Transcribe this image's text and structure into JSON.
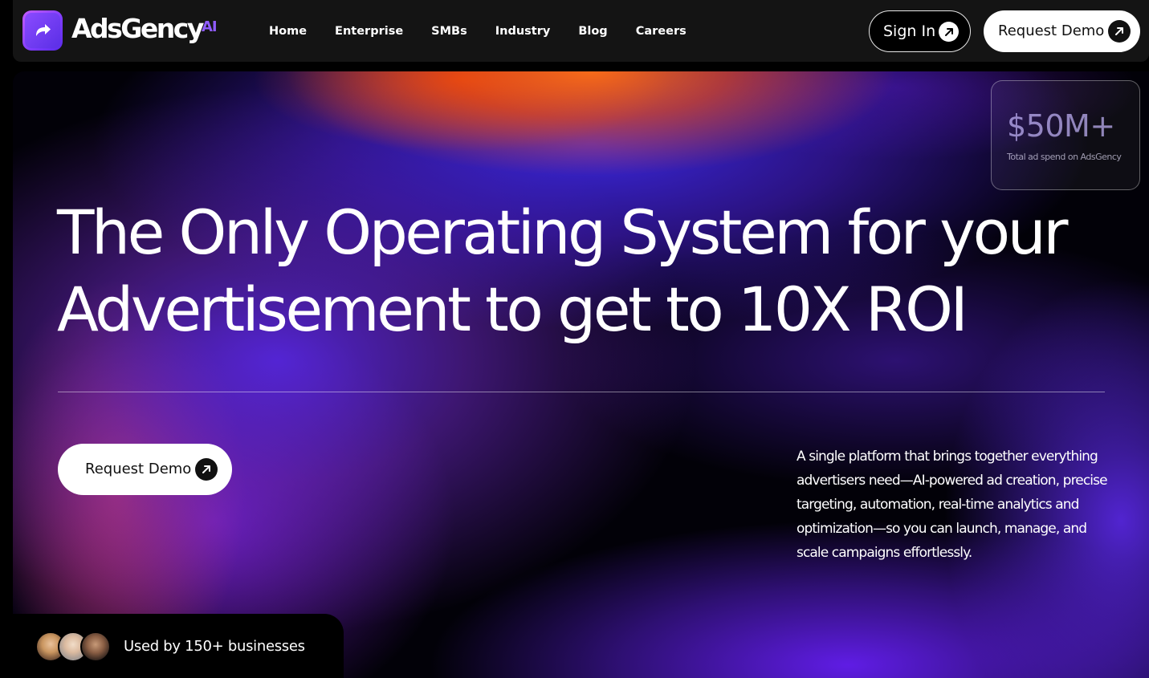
{
  "brand": {
    "name": "AdsGency",
    "suffix": "AI",
    "accent_color": "#8f5bff"
  },
  "nav": {
    "links": [
      "Home",
      "Enterprise",
      "SMBs",
      "Industry",
      "Blog",
      "Careers"
    ],
    "sign_in_label": "Sign In",
    "request_demo_label": "Request Demo"
  },
  "hero": {
    "stat": {
      "value": "$50M+",
      "caption": "Total ad spend on AdsGency"
    },
    "headline_line1": "The Only Operating System for your",
    "headline_line2": "Advertisement to get to 10X ROI",
    "cta_label": "Request Demo",
    "description": "A single platform that brings together everything advertisers need—AI-powered ad creation, precise targeting, automation, real-time analytics and optimization—so you can launch, manage, and scale campaigns effortlessly.",
    "social_proof": "Used by  150+  businesses"
  }
}
